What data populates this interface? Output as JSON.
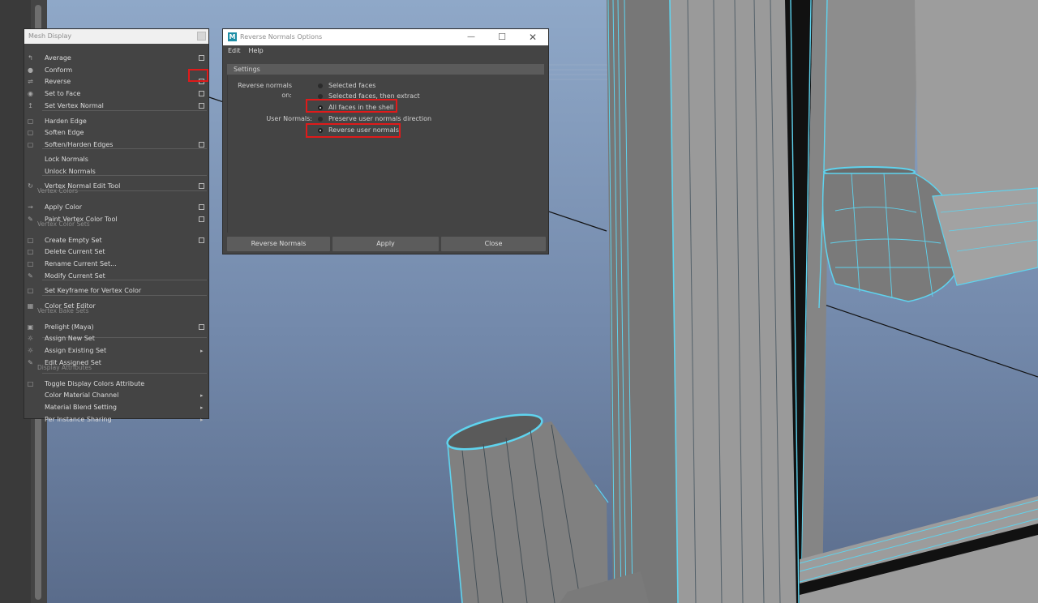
{
  "mesh_menu": {
    "title": "Mesh Display",
    "items": [
      {
        "label": "Average",
        "icon": "average-normals-icon",
        "option": true
      },
      {
        "label": "Conform",
        "icon": "conform-icon",
        "option": false
      },
      {
        "label": "Reverse",
        "icon": "reverse-normals-icon",
        "option": true
      },
      {
        "label": "Set to Face",
        "icon": "set-to-face-icon",
        "option": true
      },
      {
        "label": "Set Vertex Normal",
        "icon": "set-vertex-normal-icon",
        "option": true
      },
      {
        "label": "Harden Edge",
        "icon": "harden-edge-icon",
        "option": false
      },
      {
        "label": "Soften Edge",
        "icon": "soften-edge-icon",
        "option": false
      },
      {
        "label": "Soften/Harden Edges",
        "icon": "soften-harden-icon",
        "option": true
      },
      {
        "label": "Lock Normals",
        "icon": "lock-normals-icon",
        "option": false
      },
      {
        "label": "Unlock Normals",
        "icon": "unlock-normals-icon",
        "option": false
      },
      {
        "label": "Vertex Normal Edit Tool",
        "icon": "vertex-normal-edit-icon",
        "option": true
      },
      {
        "label": "Apply Color",
        "icon": "apply-color-icon",
        "option": true
      },
      {
        "label": "Paint Vertex Color Tool",
        "icon": "paint-brush-icon",
        "option": true
      },
      {
        "label": "Create Empty Set",
        "icon": "create-set-icon",
        "option": true
      },
      {
        "label": "Delete Current Set",
        "icon": "delete-set-icon",
        "option": false
      },
      {
        "label": "Rename Current Set...",
        "icon": "rename-set-icon",
        "option": false
      },
      {
        "label": "Modify Current Set",
        "icon": "modify-set-icon",
        "option": false
      },
      {
        "label": "Set Keyframe for Vertex Color",
        "icon": "keyframe-color-icon",
        "option": false
      },
      {
        "label": "Color Set Editor",
        "icon": "color-set-editor-icon",
        "option": false
      },
      {
        "label": "Prelight (Maya)",
        "icon": "prelight-icon",
        "option": true
      },
      {
        "label": "Assign New Set",
        "icon": "assign-new-set-icon",
        "option": false
      },
      {
        "label": "Assign Existing Set",
        "icon": "assign-existing-set-icon",
        "submenu": true
      },
      {
        "label": "Edit Assigned Set",
        "icon": "edit-assigned-set-icon",
        "option": false
      },
      {
        "label": "Toggle Display Colors Attribute",
        "icon": "toggle-display-colors-icon",
        "option": false
      },
      {
        "label": "Color Material Channel",
        "icon": "",
        "submenu": true
      },
      {
        "label": "Material Blend Setting",
        "icon": "",
        "submenu": true
      },
      {
        "label": "Per Instance Sharing",
        "icon": "",
        "submenu": true
      }
    ],
    "sections": [
      "Vertex Colors",
      "Vertex Color Sets",
      "Vertex Bake Sets",
      "Display Attributes"
    ]
  },
  "options_window": {
    "title": "Reverse Normals Options",
    "menus": [
      "Edit",
      "Help"
    ],
    "section_title": "Settings",
    "reverse_on_label": "Reverse normals on:",
    "reverse_on_options": [
      "Selected faces",
      "Selected faces, then extract",
      "All faces in the shell"
    ],
    "reverse_on_selected": "All faces in the shell",
    "user_normals_label": "User Normals:",
    "user_normals_options": [
      "Preserve user normals direction",
      "Reverse user normals"
    ],
    "user_normals_selected": "Reverse user normals",
    "buttons": [
      "Reverse Normals",
      "Apply",
      "Close"
    ]
  },
  "colors": {
    "wireframe": "#5fd3ee",
    "highlight": "#e01a1a",
    "viewport_top": "#8aa3c4",
    "viewport_bottom": "#5c6f8e"
  }
}
